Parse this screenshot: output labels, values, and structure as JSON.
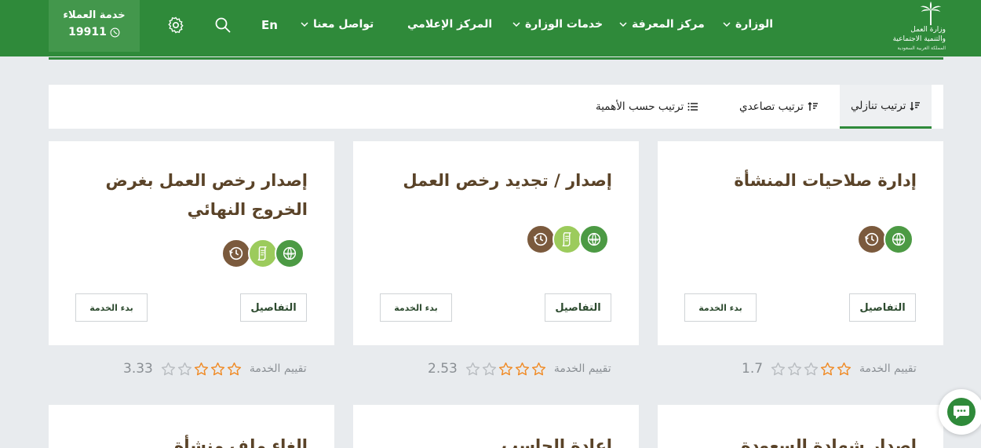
{
  "header": {
    "customer_service_title": "خدمة العملاء",
    "customer_service_number": "19911",
    "lang_label": "En",
    "nav": [
      {
        "label": "الوزارة"
      },
      {
        "label": "مركز المعرفة"
      },
      {
        "label": "خدمات الوزارة"
      },
      {
        "label": "المركز الإعلامي"
      },
      {
        "label": "تواصل معنا"
      }
    ],
    "logo_line1": "وزارة العمل",
    "logo_line2": "والتنمية الاجتماعية",
    "logo_line3": "المملكة العربية السعودية"
  },
  "sort": {
    "desc_label": "ترتيب تنازلي",
    "asc_label": "ترتيب تصاعدي",
    "importance_label": "ترتيب حسب الأهمية"
  },
  "cards": [
    {
      "title": "إدارة صلاحيات المنشأة",
      "icons": [
        "web-icon",
        "clock-icon"
      ],
      "details_label": "التفاصيل",
      "start_label": "بدء الخدمة",
      "rating_label": "تقييم الخدمة",
      "rating_value": "1.7",
      "rating_stars": 1.7
    },
    {
      "title": "إصدار / تجديد رخص العمل",
      "icons": [
        "web-icon",
        "document-icon",
        "clock-icon"
      ],
      "details_label": "التفاصيل",
      "start_label": "بدء الخدمة",
      "rating_label": "تقييم الخدمة",
      "rating_value": "2.53",
      "rating_stars": 2.53
    },
    {
      "title": "إصدار رخص العمل بغرض الخروج النهائي",
      "icons": [
        "web-icon",
        "document-icon",
        "clock-icon"
      ],
      "details_label": "التفاصيل",
      "start_label": "بدء الخدمة",
      "rating_label": "تقييم الخدمة",
      "rating_value": "3.33",
      "rating_stars": 3.33
    },
    {
      "title": "إصدار شهادة السعودة"
    },
    {
      "title": "إعادة الحاسب"
    },
    {
      "title": "الغاء ملف منشأة"
    }
  ],
  "colors": {
    "brand_green": "#2f8a3a",
    "title_brown": "#5a4328",
    "star_orange": "#f08a24"
  }
}
